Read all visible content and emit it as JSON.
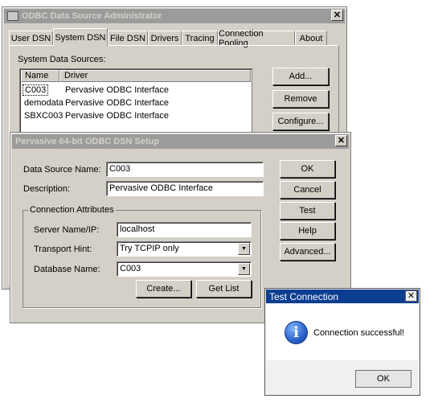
{
  "admin": {
    "title": "ODBC Data Source Administrator",
    "tabs": [
      "User DSN",
      "System DSN",
      "File DSN",
      "Drivers",
      "Tracing",
      "Connection Pooling",
      "About"
    ],
    "list_label": "System Data Sources:",
    "columns": [
      "Name",
      "Driver"
    ],
    "rows": [
      {
        "name": "C003",
        "driver": "Pervasive ODBC Interface"
      },
      {
        "name": "demodata",
        "driver": "Pervasive ODBC Interface"
      },
      {
        "name": "SBXC003",
        "driver": "Pervasive ODBC Interface"
      }
    ],
    "add": "Add...",
    "remove": "Remove",
    "configure": "Configure..."
  },
  "setup": {
    "title": "Pervasive 64-bit ODBC DSN Setup",
    "dsn_label": "Data Source Name:",
    "dsn_value": "C003",
    "desc_label": "Description:",
    "desc_value": "Pervasive ODBC Interface",
    "group_label": "Connection Attributes",
    "server_label": "Server Name/IP:",
    "server_value": "localhost",
    "transport_label": "Transport Hint:",
    "transport_value": "Try TCPIP only",
    "db_label": "Database Name:",
    "db_value": "C003",
    "create": "Create...",
    "getlist": "Get List",
    "ok": "OK",
    "cancel": "Cancel",
    "test": "Test",
    "help": "Help",
    "advanced": "Advanced..."
  },
  "test_dialog": {
    "title": "Test Connection",
    "message": "Connection successful!",
    "ok": "OK",
    "icon": "info-icon"
  },
  "colors": {
    "dialog_face": "#d4d0c8",
    "active_title": "#0a246a",
    "inactive_title": "#9b9b9b",
    "info_blue": "#2a62c9"
  }
}
